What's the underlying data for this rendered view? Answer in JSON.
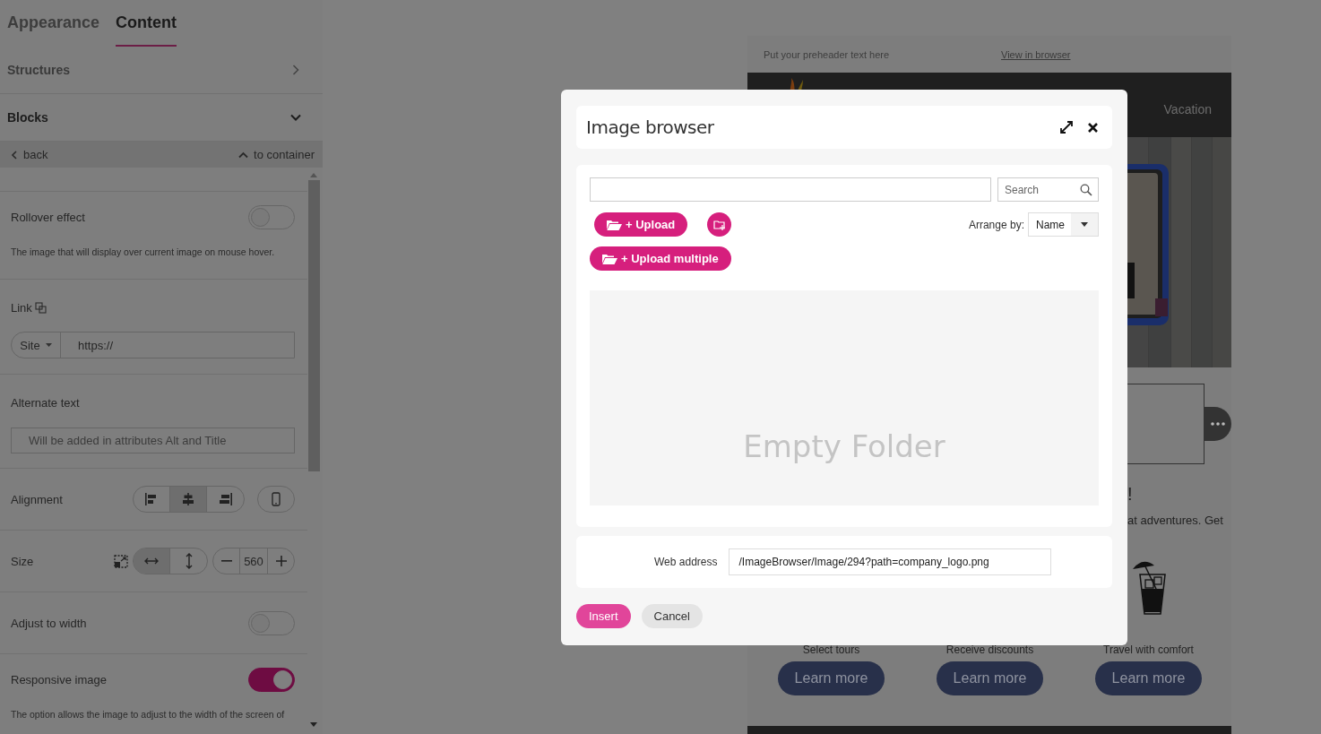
{
  "sidebar": {
    "tabs": [
      {
        "label": "Appearance",
        "selected": false
      },
      {
        "label": "Content",
        "selected": true
      }
    ],
    "sections": [
      {
        "label": "Structures",
        "expanded": false
      },
      {
        "label": "Blocks",
        "expanded": true
      }
    ],
    "nav": {
      "back": "back",
      "up": "to container"
    },
    "settings": [
      {
        "kind": "toggle",
        "label": "Rollover effect",
        "on": false,
        "hint": "The image that will display over current image on mouse hover."
      },
      {
        "kind": "link",
        "label": "Link",
        "type": "Site",
        "value": "https://"
      },
      {
        "kind": "text",
        "label": "Alternate text",
        "placeholder": "Will be added in attributes Alt and Title"
      },
      {
        "kind": "alignment",
        "label": "Alignment",
        "options": [
          {
            "selected": false
          },
          {
            "selected": true
          },
          {
            "selected": false
          }
        ]
      },
      {
        "kind": "size",
        "label": "Size",
        "modes": [
          {
            "selected": true
          },
          {
            "selected": false
          }
        ],
        "value": "560"
      },
      {
        "kind": "toggle",
        "label": "Adjust to width",
        "on": false
      },
      {
        "kind": "toggle",
        "label": "Responsive image",
        "on": true,
        "hint": "The option allows the image to adjust to the width of the screen of"
      }
    ]
  },
  "email": {
    "preheader": "Put your preheader text here",
    "view_link": "View in browser",
    "menu_item": "Vacation",
    "heading_fragment": "!",
    "text_fragment": "at adventures. Get",
    "features": [
      {
        "label": "Select tours",
        "button": "Learn more"
      },
      {
        "label": "Receive discounts",
        "button": "Learn more"
      },
      {
        "label": "Travel with comfort",
        "button": "Learn more"
      }
    ]
  },
  "dialog": {
    "title": "Image browser",
    "search": {
      "placeholder": "Search"
    },
    "upload": "+ Upload",
    "upload_multiple": "+ Upload multiple",
    "arrange_label": "Arrange by:",
    "arrange_value": "Name",
    "empty": "Empty Folder",
    "web_label": "Web address",
    "web_value": "/ImageBrowser/Image/294?path=company_logo.png",
    "insert": "Insert",
    "cancel": "Cancel"
  }
}
